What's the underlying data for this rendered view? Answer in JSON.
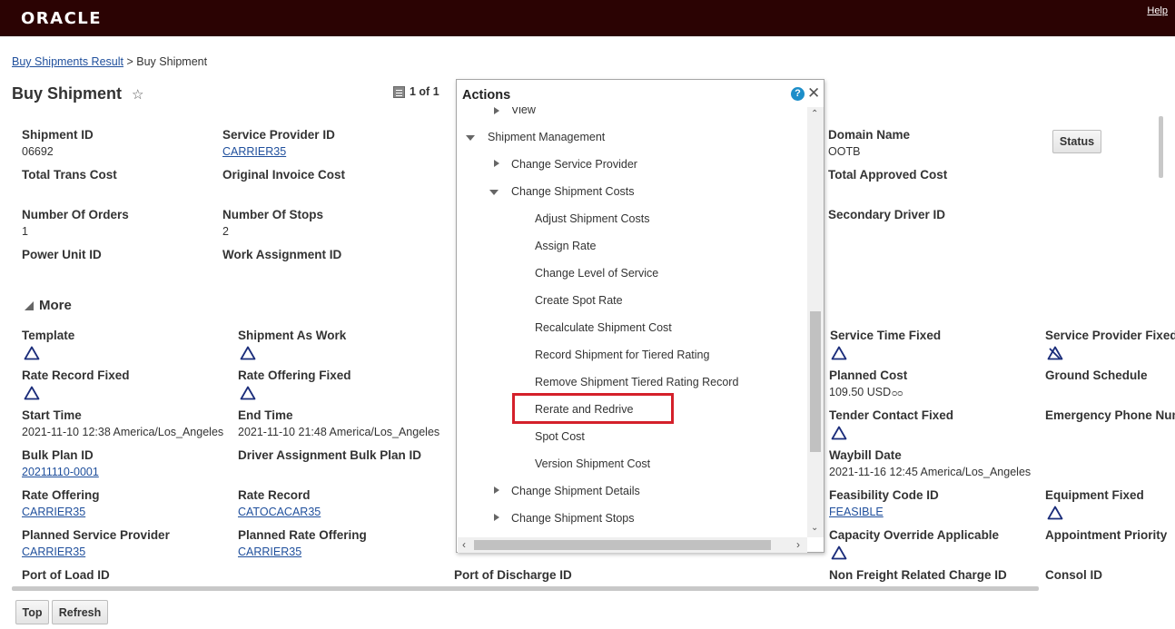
{
  "header": {
    "logo": "ORACLE",
    "help": "Help"
  },
  "breadcrumb": {
    "parent": "Buy Shipments Result",
    "separator": ">",
    "current": "Buy Shipment"
  },
  "page": {
    "title": "Buy Shipment",
    "pager": "1 of 1"
  },
  "fields": {
    "shipment_id": {
      "label": "Shipment ID",
      "value": "06692"
    },
    "service_provider_id": {
      "label": "Service Provider ID",
      "value": "CARRIER35"
    },
    "domain_name": {
      "label": "Domain Name",
      "value": "OOTB"
    },
    "total_trans_cost": {
      "label": "Total Trans Cost"
    },
    "original_invoice_cost": {
      "label": "Original Invoice Cost"
    },
    "total_approved_cost": {
      "label": "Total Approved Cost"
    },
    "number_of_orders": {
      "label": "Number Of Orders",
      "value": "1"
    },
    "number_of_stops": {
      "label": "Number Of Stops",
      "value": "2"
    },
    "secondary_driver_id": {
      "label": "Secondary Driver ID"
    },
    "power_unit_id": {
      "label": "Power Unit ID"
    },
    "work_assignment_id": {
      "label": "Work Assignment ID"
    }
  },
  "status_button": "Status",
  "more": {
    "label": "More",
    "template": {
      "label": "Template"
    },
    "shipment_as_work": {
      "label": "Shipment As Work"
    },
    "service_time_fixed": {
      "label": "Service Time Fixed"
    },
    "service_provider_fixed": {
      "label": "Service Provider Fixed"
    },
    "rate_record_fixed": {
      "label": "Rate Record Fixed"
    },
    "rate_offering_fixed": {
      "label": "Rate Offering Fixed"
    },
    "planned_cost": {
      "label": "Planned Cost",
      "value": "109.50 USD"
    },
    "ground_schedule": {
      "label": "Ground Schedule"
    },
    "start_time": {
      "label": "Start Time",
      "value": "2021-11-10 12:38 America/Los_Angeles"
    },
    "end_time": {
      "label": "End Time",
      "value": "2021-11-10 21:48 America/Los_Angeles"
    },
    "tender_contact_fixed": {
      "label": "Tender Contact Fixed"
    },
    "emergency_phone": {
      "label": "Emergency Phone Number"
    },
    "bulk_plan_id": {
      "label": "Bulk Plan ID",
      "value": "20211110-0001"
    },
    "driver_assignment_bulk_plan_id": {
      "label": "Driver Assignment Bulk Plan ID"
    },
    "waybill_date": {
      "label": "Waybill Date",
      "value": "2021-11-16 12:45 America/Los_Angeles"
    },
    "rate_offering": {
      "label": "Rate Offering",
      "value": "CARRIER35"
    },
    "rate_record": {
      "label": "Rate Record",
      "value": "CATOCACAR35"
    },
    "feasibility_code_id": {
      "label": "Feasibility Code ID",
      "value": "FEASIBLE"
    },
    "equipment_fixed": {
      "label": "Equipment Fixed"
    },
    "planned_service_provider": {
      "label": "Planned Service Provider",
      "value": "CARRIER35"
    },
    "planned_rate_offering": {
      "label": "Planned Rate Offering",
      "value": "CARRIER35"
    },
    "capacity_override_applicable": {
      "label": "Capacity Override Applicable"
    },
    "appointment_priority": {
      "label": "Appointment Priority"
    },
    "port_of_load_id": {
      "label": "Port of Load ID"
    },
    "port_of_discharge_id": {
      "label": "Port of Discharge ID"
    },
    "non_freight_related_charge_id": {
      "label": "Non Freight Related Charge ID"
    },
    "consol_id": {
      "label": "Consol ID"
    }
  },
  "buttons": {
    "top": "Top",
    "refresh": "Refresh"
  },
  "actions_popup": {
    "title": "Actions",
    "items": [
      "View",
      "Shipment Management",
      "Change Service Provider",
      "Change Shipment Costs",
      "Adjust Shipment Costs",
      "Assign Rate",
      "Change Level of Service",
      "Create Spot Rate",
      "Recalculate Shipment Cost",
      "Record Shipment for Tiered Rating",
      "Remove Shipment Tiered Rating Record",
      "Rerate and Redrive",
      "Spot Cost",
      "Version Shipment Cost",
      "Change Shipment Details",
      "Change Shipment Stops"
    ],
    "highlighted": "Rerate and Redrive"
  },
  "colors": {
    "header_bg": "#2b0303",
    "link": "#1f4f9c",
    "highlight": "#d4202a",
    "help_icon": "#1d8ec9"
  }
}
